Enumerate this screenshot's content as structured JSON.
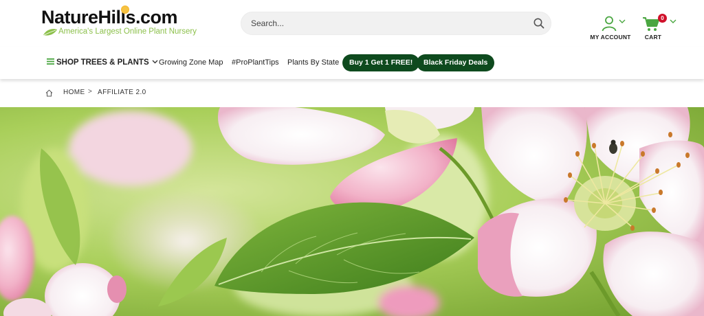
{
  "header": {
    "logo_text": "NatureHills.com",
    "logo_tagline": "America's Largest Online Plant Nursery",
    "search": {
      "placeholder": "Search...",
      "value": ""
    },
    "account_label": "MY ACCOUNT",
    "cart_label": "CART",
    "cart_count": "0"
  },
  "nav": {
    "shop_label": "SHOP TREES & PLANTS",
    "links": [
      "Growing Zone Map",
      "#ProPlantTips",
      "Plants By State"
    ],
    "promos": [
      "Buy 1 Get 1 FREE!",
      "Black Friday Deals"
    ]
  },
  "breadcrumb": {
    "home": "HOME",
    "separator": ">",
    "current": "AFFILIATE 2.0"
  },
  "colors": {
    "brand_green": "#0e4a1e",
    "leaf_green": "#8cc04b",
    "icon_green": "#4aa641",
    "badge_red": "#d0112b",
    "search_bg": "#f1f1f1"
  },
  "icons": [
    "search-icon",
    "user-icon",
    "cart-icon",
    "chevron-down-icon",
    "menu-icon",
    "home-icon"
  ]
}
